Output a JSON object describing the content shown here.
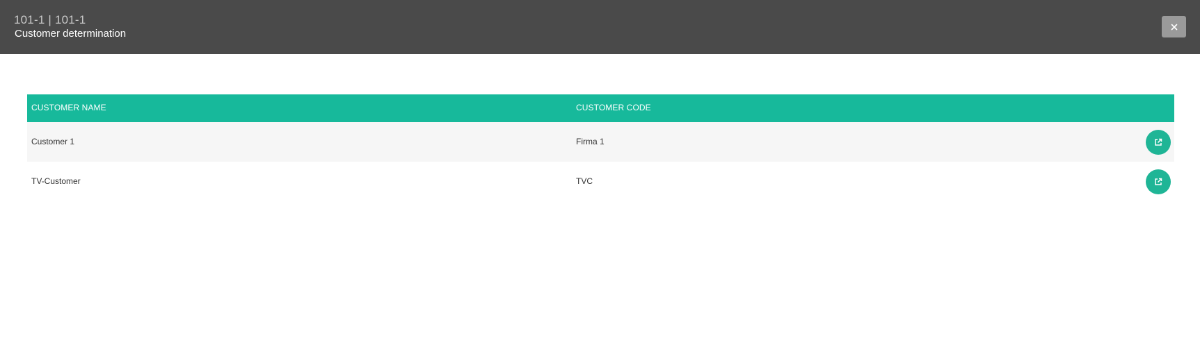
{
  "header": {
    "subtitle": "101-1 | 101-1",
    "title": "Customer determination",
    "close_label": "×"
  },
  "table": {
    "columns": [
      "CUSTOMER NAME",
      "CUSTOMER CODE"
    ],
    "rows": [
      {
        "name": "Customer 1",
        "code": "Firma 1",
        "action_icon": "external-link-icon"
      },
      {
        "name": "TV-Customer",
        "code": "TVC",
        "action_icon": "external-link-icon"
      }
    ]
  },
  "colors": {
    "header_bg": "#4a4a4a",
    "accent": "#17b99b",
    "row_alt": "#f6f6f6"
  }
}
